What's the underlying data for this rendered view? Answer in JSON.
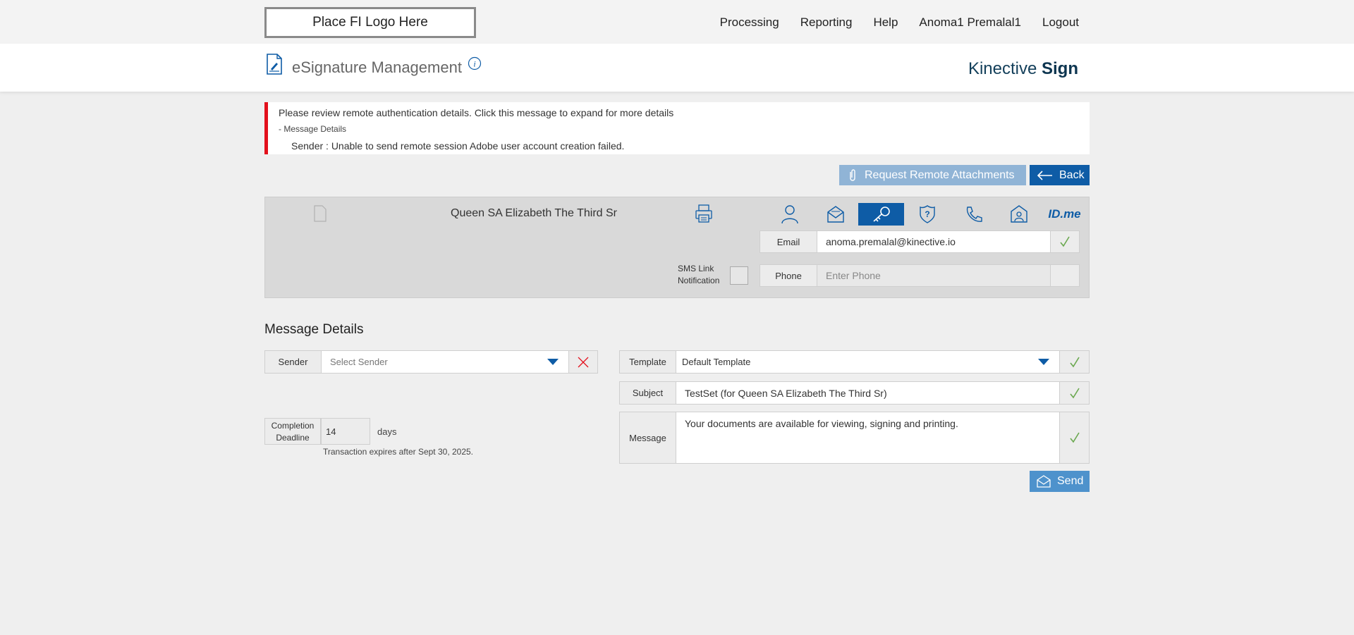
{
  "topbar": {
    "logo_text": "Place FI Logo Here",
    "nav": [
      "Processing",
      "Reporting",
      "Help",
      "Anoma1 Premalal1",
      "Logout"
    ]
  },
  "header": {
    "title": "eSignature Management",
    "brand_light": "Kinective",
    "brand_bold": "Sign"
  },
  "alert": {
    "summary": "Please review remote authentication details. Click this message to expand for more details",
    "details_toggle": "- Message Details",
    "detail_line": "Sender :  Unable to send remote session Adobe user account creation failed."
  },
  "actions": {
    "request_attachments": "Request Remote Attachments",
    "back": "Back"
  },
  "recipient": {
    "name": "Queen SA Elizabeth The Third Sr",
    "auth_methods": [
      "person-icon",
      "envelope-icon",
      "key-icon",
      "security-question-icon",
      "phone-icon",
      "id-card-icon",
      "ID.me"
    ],
    "active_auth_index": 2,
    "email_label": "Email",
    "email_value": "anoma.premalal@kinective.io",
    "sms_label_line1": "SMS Link",
    "sms_label_line2": "Notification",
    "phone_label": "Phone",
    "phone_placeholder": "Enter Phone"
  },
  "message_details": {
    "title": "Message Details",
    "sender_label": "Sender",
    "sender_placeholder": "Select Sender",
    "template_label": "Template",
    "template_value": "Default Template",
    "subject_label": "Subject",
    "subject_value": "TestSet (for Queen SA Elizabeth The Third Sr)",
    "message_label": "Message",
    "message_value": "Your documents are available for viewing, signing and printing.",
    "completion_label_line1": "Completion",
    "completion_label_line2": "Deadline",
    "completion_value": "14",
    "days_label": "days",
    "expires_text": "Transaction expires after Sept 30, 2025.",
    "send": "Send"
  },
  "colors": {
    "primary": "#0e5ca6",
    "alert_red": "#e3101c",
    "check_green": "#6aa84f"
  }
}
